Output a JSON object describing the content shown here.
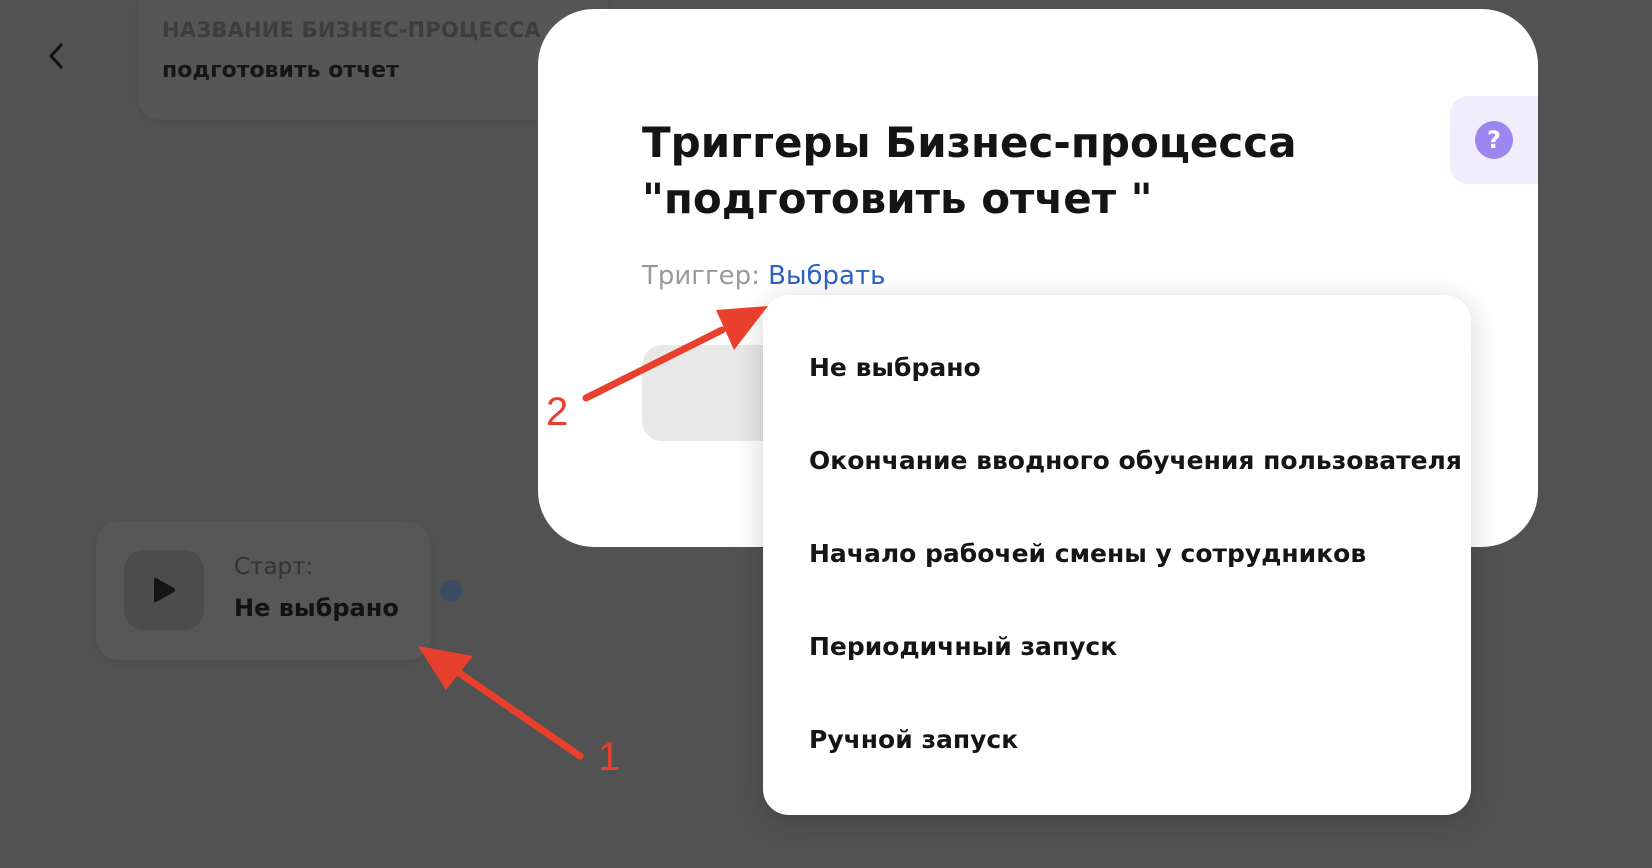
{
  "header": {
    "label": "НАЗВАНИЕ БИЗНЕС-ПРОЦЕССА",
    "value": "подготовить отчет"
  },
  "start_node": {
    "label": "Старт:",
    "value": "Не выбрано"
  },
  "modal": {
    "title_line1": "Триггеры Бизнес-процесса",
    "title_line2": "\"подготовить отчет \"",
    "trigger_label": "Триггер:",
    "trigger_link": "Выбрать"
  },
  "dropdown": {
    "items": [
      "Не выбрано",
      "Окончание вводного обучения пользователя",
      "Начало рабочей смены у сотрудников",
      "Периодичный запуск",
      "Ручной запуск"
    ]
  },
  "annotations": {
    "marker_1": "1",
    "marker_2": "2"
  },
  "icons": {
    "back": "chevron-left-icon",
    "play": "play-icon",
    "help": "question-icon"
  },
  "colors": {
    "overlay": "#525252",
    "link": "#2e61c5",
    "help_accent": "#9b87ef",
    "annotation": "#e8402c"
  }
}
